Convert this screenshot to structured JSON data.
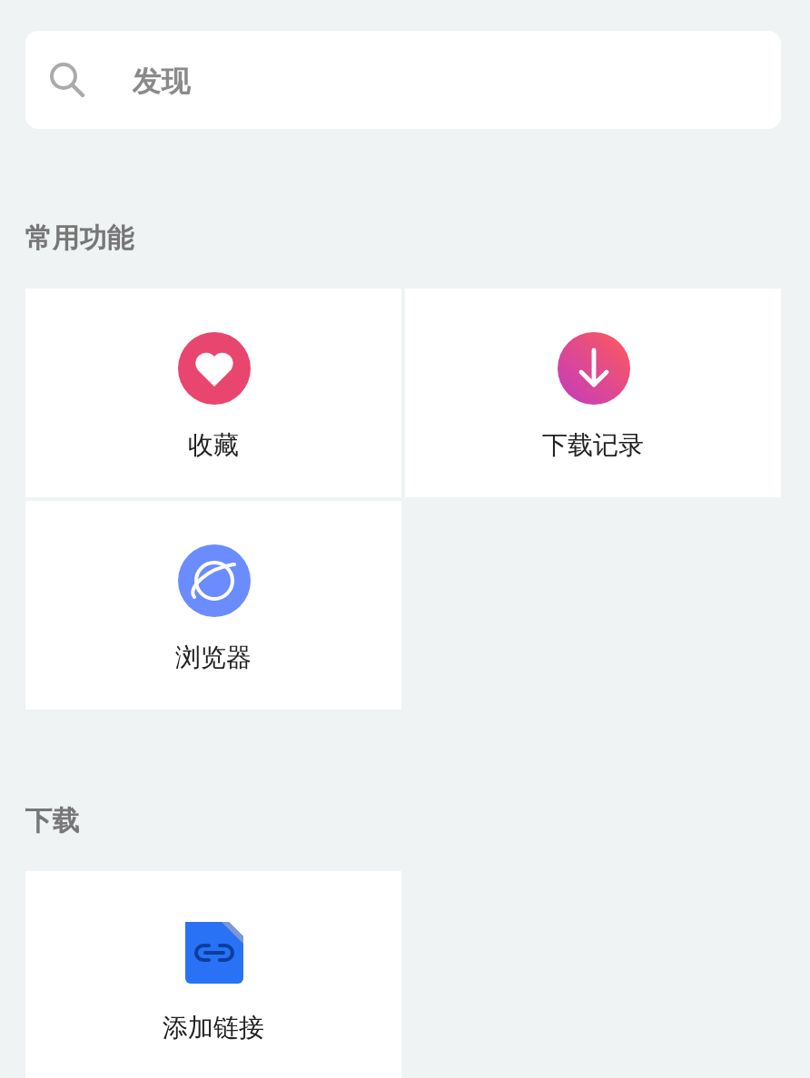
{
  "search": {
    "placeholder": "发现"
  },
  "sections": [
    {
      "title": "常用功能",
      "items": [
        {
          "label": "收藏",
          "kind": "heart"
        },
        {
          "label": "下载记录",
          "kind": "download"
        },
        {
          "label": "浏览器",
          "kind": "planet"
        }
      ]
    },
    {
      "title": "下载",
      "items": [
        {
          "label": "添加链接",
          "kind": "link"
        }
      ]
    }
  ]
}
